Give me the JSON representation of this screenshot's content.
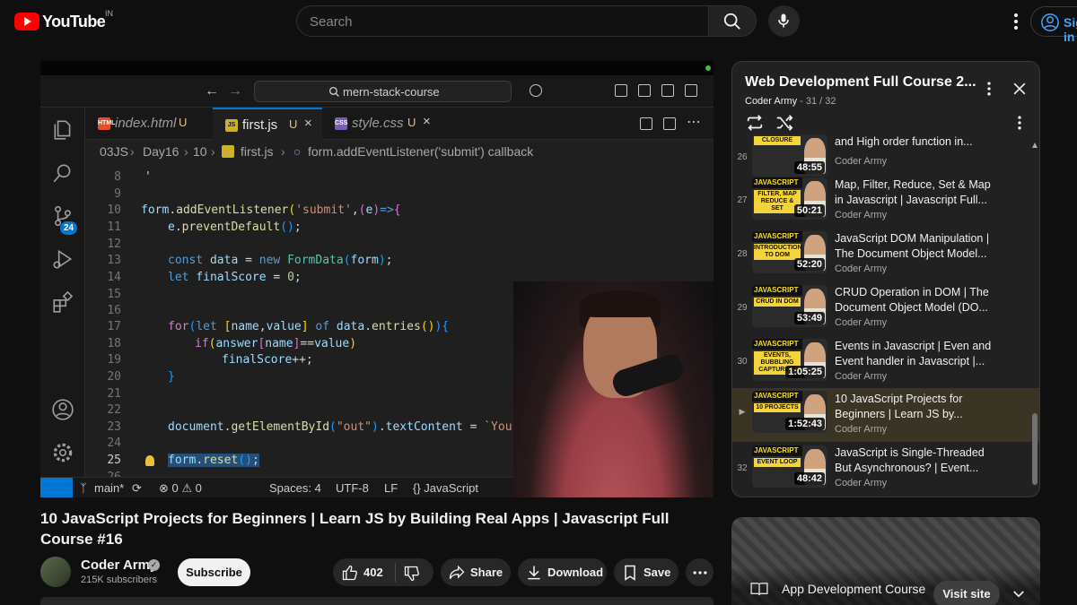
{
  "header": {
    "logo_text": "YouTube",
    "country_code": "IN",
    "search_placeholder": "Search",
    "signin_label": "Sign in",
    "brand_color": "#ff0000"
  },
  "player": {
    "vscode": {
      "command_center": "mern-stack-course",
      "scm_badge": "24",
      "tabs": [
        {
          "name": "index.html",
          "status": "U",
          "icon": "HTML"
        },
        {
          "name": "first.js",
          "status": "U",
          "icon": "JS"
        },
        {
          "name": "style.css",
          "status": "U",
          "icon": "CSS"
        }
      ],
      "breadcrumb": [
        "03JS",
        "Day16",
        "10",
        "first.js",
        "form.addEventListener('submit') callback"
      ],
      "status": {
        "branch": "main*",
        "problems": "⊗ 0 ⚠ 0",
        "spaces": "Spaces: 4",
        "encoding": "UTF-8",
        "eol": "LF",
        "language": "{} JavaScript"
      }
    }
  },
  "video": {
    "title": "10 JavaScript Projects for Beginners | Learn JS by Building Real Apps | Javascript Full Course #16",
    "channel": "Coder Army",
    "subscribers": "215K subscribers",
    "subscribe_label": "Subscribe",
    "likes": "402",
    "share_label": "Share",
    "download_label": "Download",
    "save_label": "Save"
  },
  "playlist": {
    "title": "Web Development Full Course 2...",
    "channel": "Coder Army",
    "position": "- 31 / 32",
    "items": [
      {
        "index": "26",
        "title": "and High order function in...",
        "channel": "Coder Army",
        "duration": "48:55",
        "thumb_label": "CLOSURE"
      },
      {
        "index": "27",
        "title": "Map, Filter, Reduce, Set & Map in Javascript | Javascript Full...",
        "channel": "Coder Army",
        "duration": "50:21",
        "thumb_label": "FILTER, MAP REDUCE & SET"
      },
      {
        "index": "28",
        "title": "JavaScript DOM Manipulation | The Document Object Model...",
        "channel": "Coder Army",
        "duration": "52:20",
        "thumb_label": "INTRODUCTION TO DOM"
      },
      {
        "index": "29",
        "title": "CRUD Operation in DOM | The Document Object Model (DO...",
        "channel": "Coder Army",
        "duration": "53:49",
        "thumb_label": "CRUD IN DOM"
      },
      {
        "index": "30",
        "title": "Events in Javascript | Even and Event handler in Javascript |...",
        "channel": "Coder Army",
        "duration": "1:05:25",
        "thumb_label": "EVENTS, BUBBLING CAPTURING"
      },
      {
        "index": "▶",
        "title": "10 JavaScript Projects for Beginners | Learn JS by...",
        "channel": "Coder Army",
        "duration": "1:52:43",
        "thumb_label": "10 PROJECTS"
      },
      {
        "index": "32",
        "title": "JavaScript is Single-Threaded But Asynchronous? | Event...",
        "channel": "Coder Army",
        "duration": "48:42",
        "thumb_label": "EVENT LOOP"
      }
    ]
  },
  "ad": {
    "title": "App Development Course",
    "visit_label": "Visit site"
  }
}
